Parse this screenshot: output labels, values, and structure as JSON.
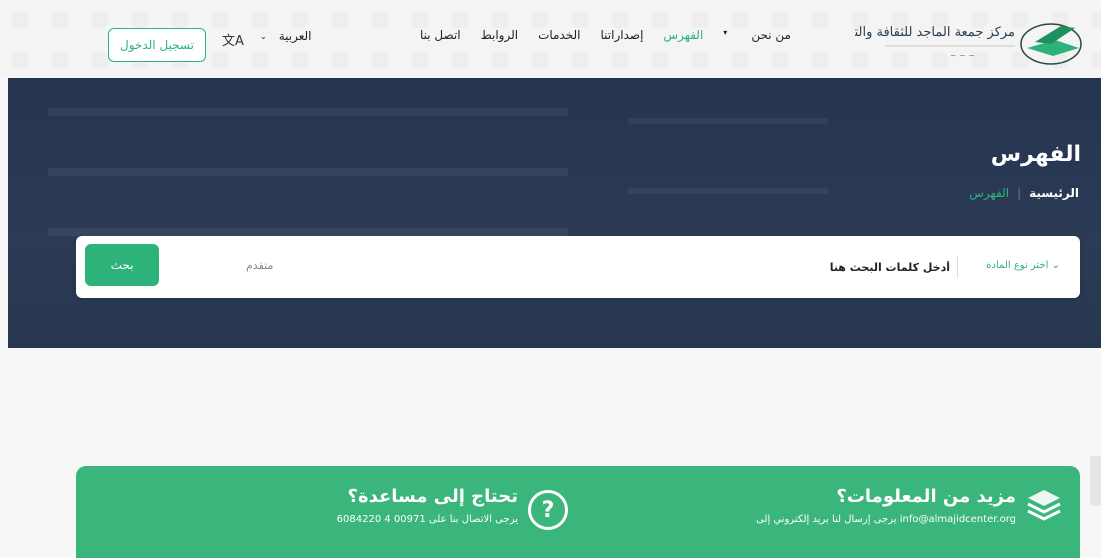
{
  "header": {
    "logo_text": "مركز جمعة الماجد للثقافة والتراث",
    "nav": [
      {
        "label": "من نحن",
        "dropdown": true,
        "active": false
      },
      {
        "label": "الفهرس",
        "dropdown": false,
        "active": true
      },
      {
        "label": "إصداراتنا",
        "dropdown": false,
        "active": false
      },
      {
        "label": "الخدمات",
        "dropdown": false,
        "active": false
      },
      {
        "label": "الروابط",
        "dropdown": false,
        "active": false
      },
      {
        "label": "اتصل بنا",
        "dropdown": false,
        "active": false
      }
    ],
    "language": "العربية",
    "login_label": "تسجيل الدخول"
  },
  "hero": {
    "title": "الفهرس",
    "breadcrumb": {
      "home": "الرئيسية",
      "current": "الفهرس"
    }
  },
  "search": {
    "type_label": "اختر نوع المادة",
    "placeholder": "أدخل كلمات البحث هنا",
    "advanced_label": "متقدم",
    "button_label": "بحث"
  },
  "band": {
    "info_title": "مزيد من المعلومات؟",
    "info_text": "يرجى إرسال لنا بريد إلكتروني إلى info@almajidcenter.org",
    "help_title": "تحتاج إلى مساعدة؟",
    "help_text": "يرجى الاتصال بنا على 00971 4 6084220"
  },
  "colors": {
    "accent": "#2db37a",
    "hero": "#27374f",
    "band": "#3ab57b"
  }
}
